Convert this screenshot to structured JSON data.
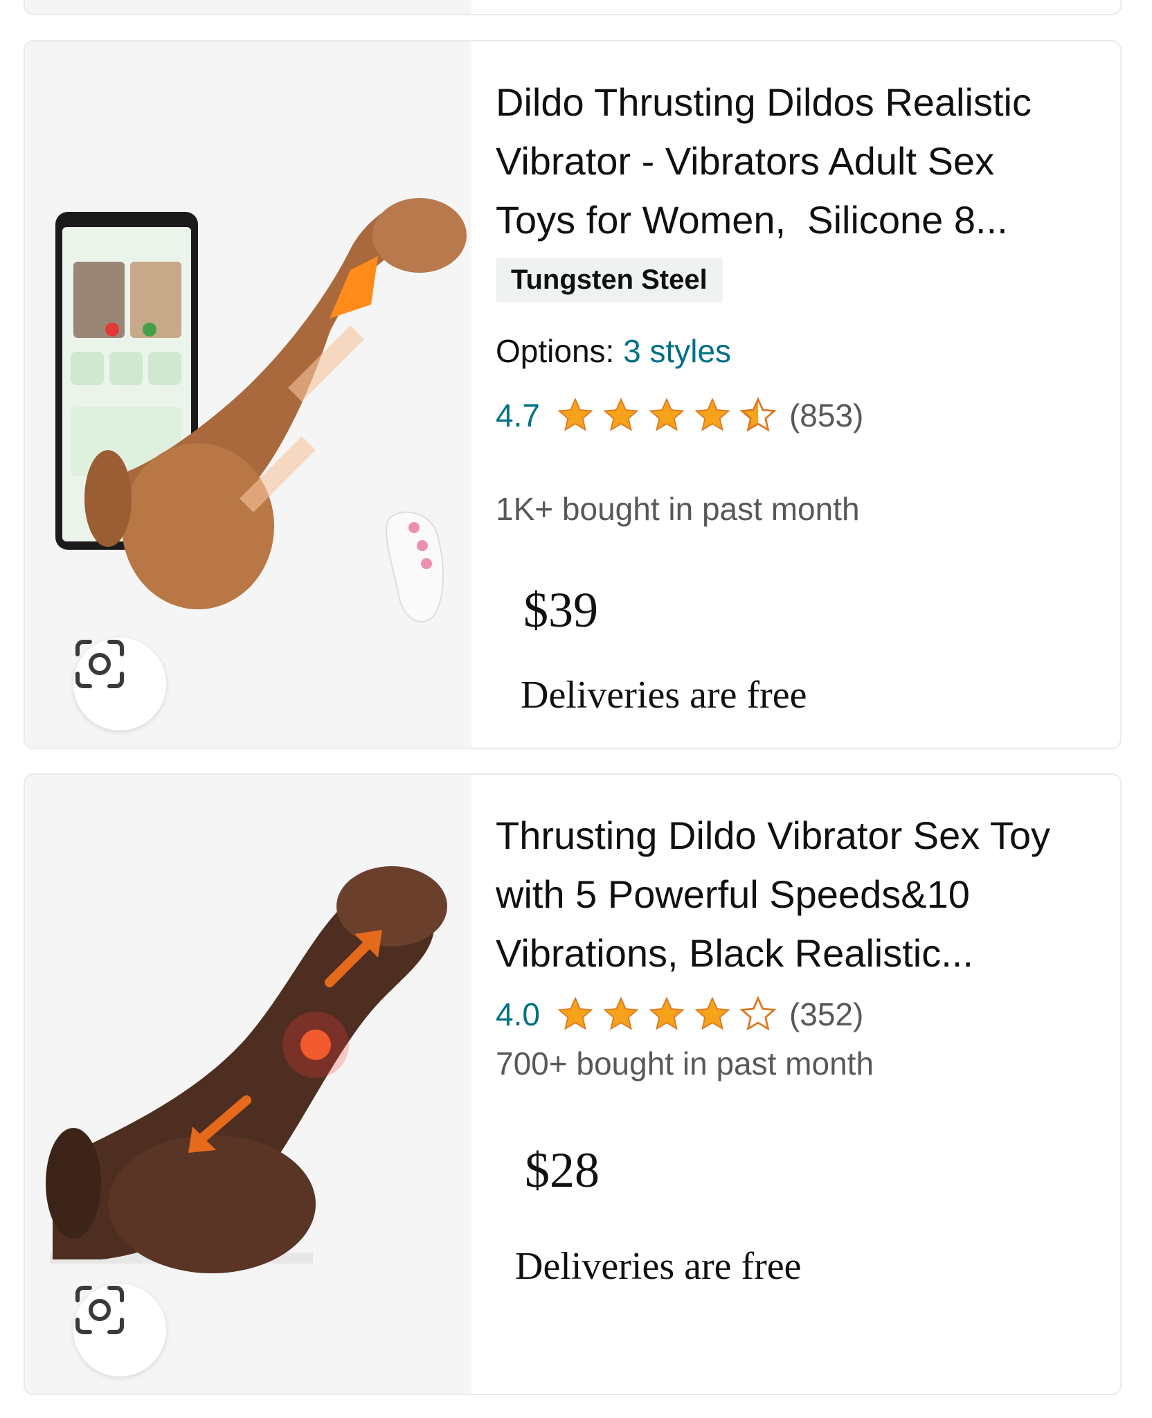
{
  "products": [
    {
      "title_lines": [
        "Dildo Thrusting Dildos Realistic",
        "Vibrator - Vibrators Adult Sex",
        "Toys for Women,  Silicone 8..."
      ],
      "badge": "Tungsten Steel",
      "options_label": "Options:",
      "options_link": "3 styles",
      "rating": "4.7",
      "stars": 4.7,
      "review_count": "(853)",
      "bought": "1K+ bought in past month",
      "price": "$39",
      "delivery": "Deliveries are free"
    },
    {
      "title_lines": [
        "Thrusting Dildo Vibrator Sex Toy",
        "with 5 Powerful Speeds&10",
        "Vibrations, Black Realistic..."
      ],
      "rating": "4.0",
      "stars": 4.0,
      "review_count": "(352)",
      "bought": "700+ bought in past month",
      "price": "$28",
      "delivery": "Deliveries are free"
    }
  ],
  "icons": {
    "lens": "camera-lens-icon",
    "star_full": "star-full-icon",
    "star_half": "star-half-icon",
    "star_empty": "star-empty-icon"
  },
  "colors": {
    "link": "#007185",
    "star": "#f7a21b",
    "star_outline": "#de7921",
    "muted": "#565959",
    "card_border": "#e9eaea",
    "media_bg": "#f5f5f5"
  }
}
